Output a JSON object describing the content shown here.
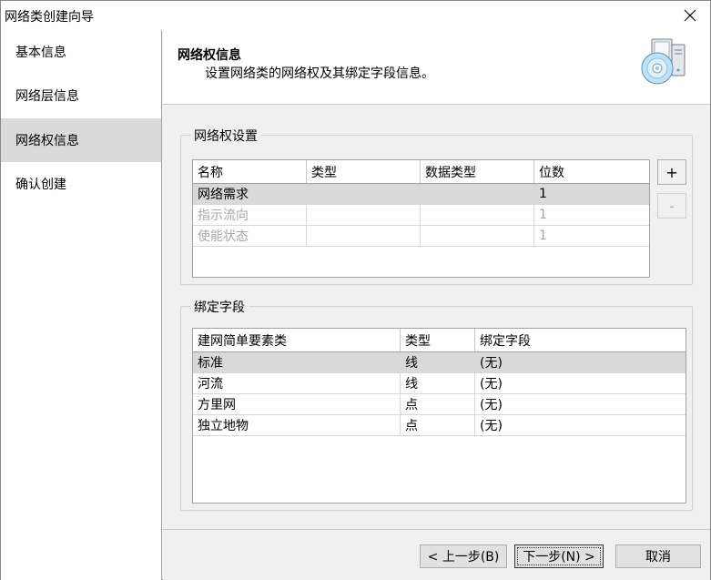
{
  "window": {
    "title": "网络类创建向导"
  },
  "sidebar": {
    "items": [
      {
        "label": "基本信息"
      },
      {
        "label": "网络层信息"
      },
      {
        "label": "网络权信息"
      },
      {
        "label": "确认创建"
      }
    ],
    "active_index": 2
  },
  "header": {
    "title": "网络权信息",
    "description": "设置网络类的网络权及其绑定字段信息。",
    "icon": "cd-computer-icon"
  },
  "weight_group": {
    "legend": "网络权设置",
    "columns": [
      "名称",
      "类型",
      "数据类型",
      "位数"
    ],
    "rows": [
      {
        "name": "网络需求",
        "type": "",
        "data_type": "",
        "digits": "1",
        "enabled": true,
        "selected": true
      },
      {
        "name": "指示流向",
        "type": "",
        "data_type": "",
        "digits": "1",
        "enabled": false,
        "selected": false
      },
      {
        "name": "使能状态",
        "type": "",
        "data_type": "",
        "digits": "1",
        "enabled": false,
        "selected": false
      }
    ],
    "add_label": "+",
    "remove_label": "-"
  },
  "bind_group": {
    "legend": "绑定字段",
    "columns": [
      "建网简单要素类",
      "类型",
      "绑定字段"
    ],
    "rows": [
      {
        "class": "标准",
        "type": "线",
        "field": "(无)",
        "selected": true
      },
      {
        "class": "河流",
        "type": "线",
        "field": "(无)",
        "selected": false
      },
      {
        "class": "方里网",
        "type": "点",
        "field": "(无)",
        "selected": false
      },
      {
        "class": "独立地物",
        "type": "点",
        "field": "(无)",
        "selected": false
      }
    ]
  },
  "footer": {
    "prev_label": "< 上一步(B)",
    "next_label": "下一步(N) >",
    "cancel_label": "取消"
  }
}
